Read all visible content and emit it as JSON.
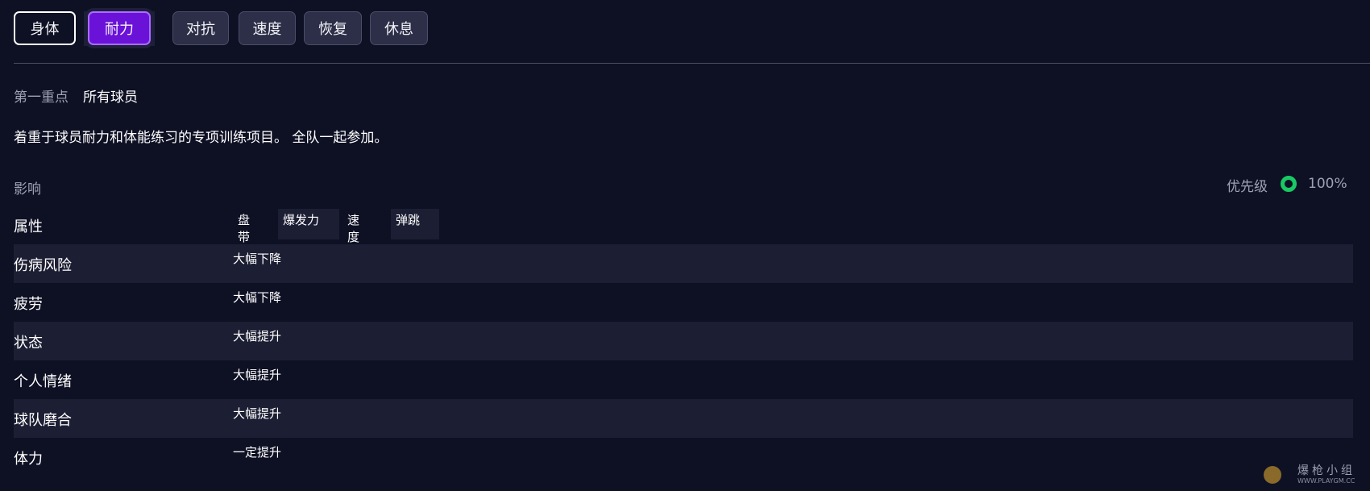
{
  "tabs": [
    "身体",
    "耐力",
    "对抗",
    "速度",
    "恢复",
    "休息"
  ],
  "focus": {
    "label": "第一重点",
    "value": "所有球员"
  },
  "description": "着重于球员耐力和体能练习的专项训练项目。 全队一起参加。",
  "impact_label": "影响",
  "priority": {
    "label": "优先级",
    "value": "100%",
    "color": "#18c964"
  },
  "rows": [
    {
      "name": "属性",
      "attributes": [
        "盘带",
        "爆发力",
        "速度",
        "弹跳"
      ]
    },
    {
      "name": "伤病风险",
      "value": "大幅下降"
    },
    {
      "name": "疲劳",
      "value": "大幅下降"
    },
    {
      "name": "状态",
      "value": "大幅提升"
    },
    {
      "name": "个人情绪",
      "value": "大幅提升"
    },
    {
      "name": "球队磨合",
      "value": "大幅提升"
    },
    {
      "name": "体力",
      "value": "一定提升"
    }
  ],
  "watermark": {
    "title": "爆枪小组",
    "subtitle": "WWW.PLAYGM.CC"
  },
  "colors": {
    "selected_tab": "#6b12d8",
    "background": "#0e1024"
  }
}
